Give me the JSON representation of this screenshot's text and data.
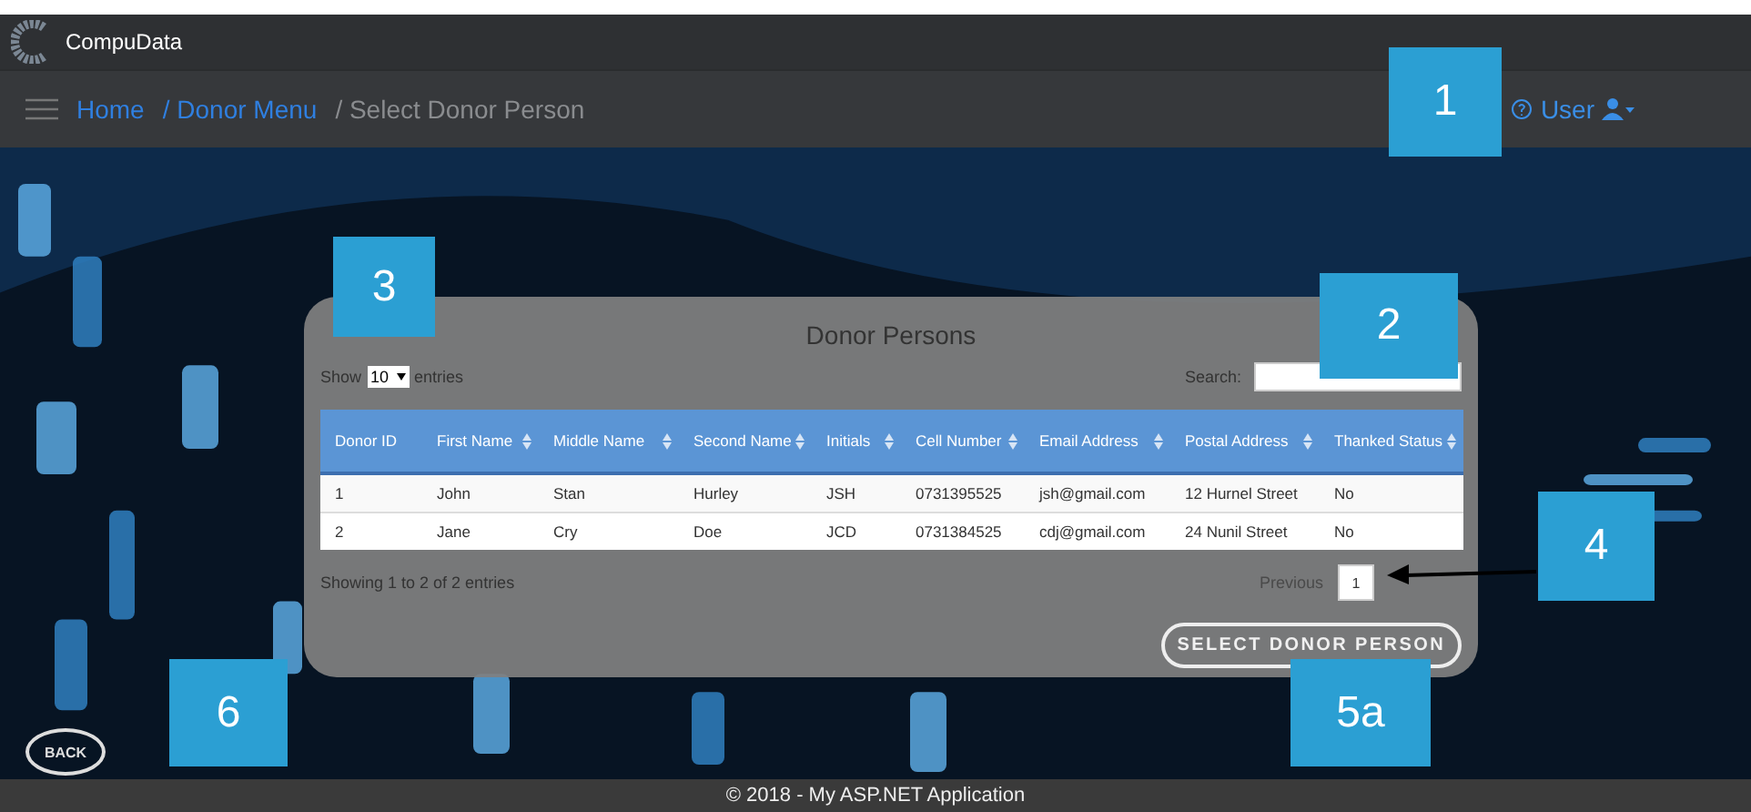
{
  "header": {
    "brand": "CompuData"
  },
  "breadcrumb": [
    {
      "label": "Home",
      "kind": "link"
    },
    {
      "label": "/ Donor Menu",
      "kind": "link"
    },
    {
      "label": "/ Select Donor Person",
      "kind": "current"
    }
  ],
  "user_menu": {
    "label": "User"
  },
  "panel": {
    "title": "Donor Persons",
    "show_label": "Show",
    "page_size": "10",
    "entries_label": "entries",
    "search_label": "Search:",
    "columns": [
      "Donor ID",
      "First Name",
      "Middle Name",
      "Second Name",
      "Initials",
      "Cell Number",
      "Email Address",
      "Postal Address",
      "Thanked Status"
    ],
    "rows": [
      [
        "1",
        "John",
        "Stan",
        "Hurley",
        "JSH",
        "0731395525",
        "jsh@gmail.com",
        "12 Hurnel Street",
        "No"
      ],
      [
        "2",
        "Jane",
        "Cry",
        "Doe",
        "JCD",
        "0731384525",
        "cdj@gmail.com",
        "24 Nunil Street",
        "No"
      ]
    ],
    "info": "Showing 1 to 2 of 2 entries",
    "pager": {
      "previous": "Previous",
      "pages": [
        {
          "label": "1",
          "selected": true
        }
      ]
    },
    "action_button": "SELECT DONOR PERSON"
  },
  "back_button": "BACK",
  "footer": "© 2018 - My ASP.NET Application",
  "callouts": [
    {
      "label": "1"
    },
    {
      "label": "2"
    },
    {
      "label": "3"
    },
    {
      "label": "4"
    },
    {
      "label": "5a"
    },
    {
      "label": "6"
    }
  ]
}
